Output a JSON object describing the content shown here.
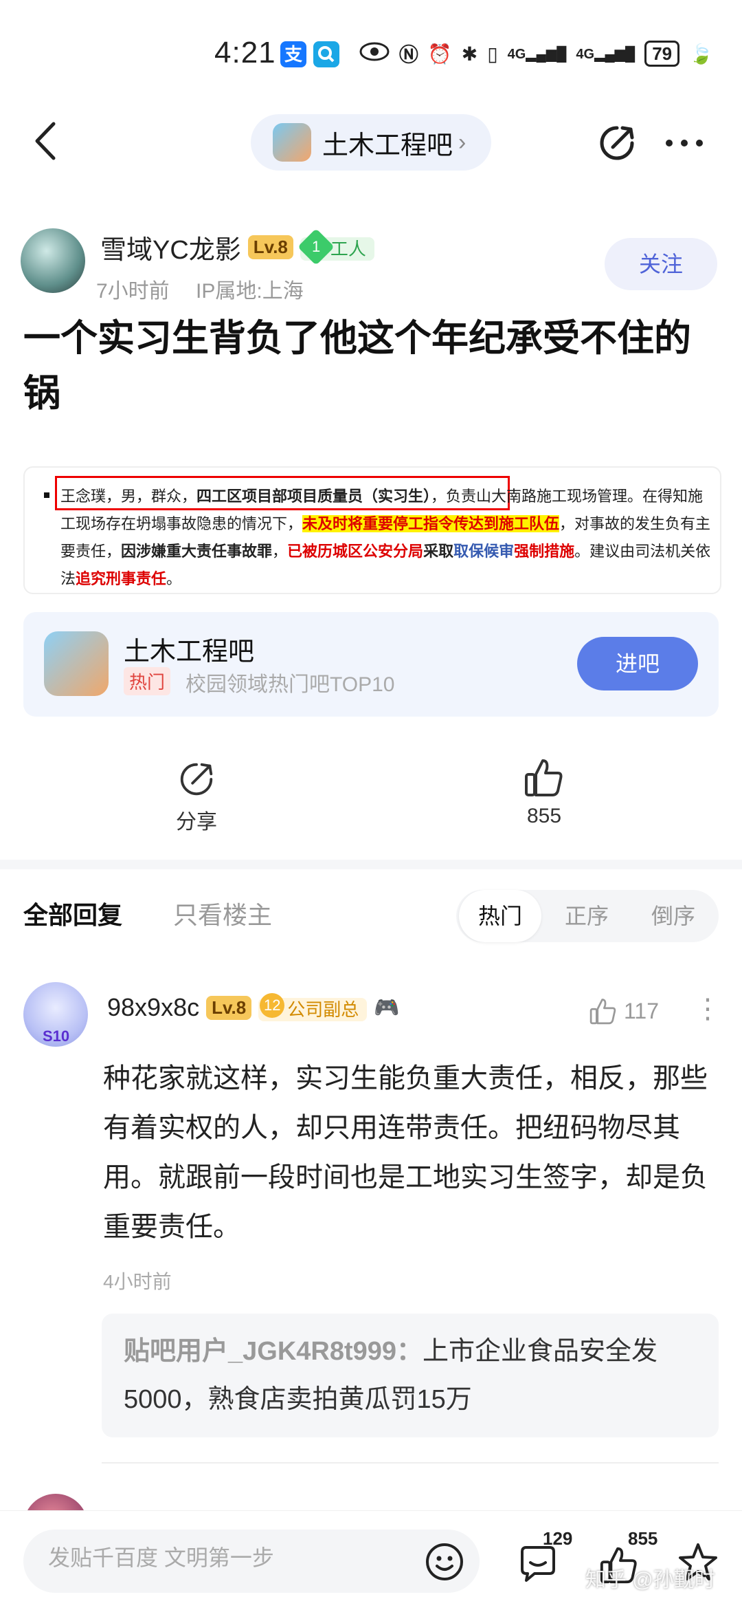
{
  "status_bar": {
    "time": "4:21",
    "app1": "支",
    "app1_color": "#1677ff",
    "app2_color": "#1ba7e6",
    "network1": "4G",
    "network2": "4G",
    "battery": "79"
  },
  "nav": {
    "forum_name": "土木工程吧",
    "chevron": "›"
  },
  "post": {
    "author_name": "雪域YC龙影",
    "author_level": "Lv.8",
    "author_title_num": "1",
    "author_title": "工人",
    "time": "7小时前",
    "ip": "IP属地:上海",
    "follow_label": "关注",
    "title": "一个实习生背负了他这个年纪承受不住的锅",
    "image_text": {
      "p1": "王念璞，男，群众，",
      "p2": "四工区项目部项目质量员（实习生）",
      "p3": "，负责山大南路施工现场管理。在得知施工现场存在坍塌事故隐患的情况下，",
      "p4": "未及时将重要停工指令传达到施工队伍",
      "p5": "，对事故的发生负有主要责任，",
      "p6": "因涉嫌重大责任事故罪",
      "p7": "，",
      "p8": "已被历城区公安分局",
      "p9": "采取",
      "p10": "取保候审",
      "p11": "强制措施",
      "p12": "。建议由司法机关依法",
      "p13": "追究刑事责任",
      "p14": "。"
    }
  },
  "forum_card": {
    "name": "土木工程吧",
    "hot_tag": "热门",
    "description": "校园领域热门吧TOP10",
    "enter_label": "进吧"
  },
  "actions": {
    "share_label": "分享",
    "like_count": "855"
  },
  "reply_tabs": {
    "all": "全部回复",
    "owner_only": "只看楼主",
    "sort": [
      "热门",
      "正序",
      "倒序"
    ]
  },
  "comment": {
    "s10": "S10",
    "username": "98x9x8c",
    "level": "Lv.8",
    "rank_num": "12",
    "rank_title": "公司副总",
    "like_count": "117",
    "body": "种花家就这样，实习生能负重大责任，相反，那些有着实权的人，却只用连带责任。把纽码物尽其用。就跟前一段时间也是工地实习生签字，却是负重要责任。",
    "time": "4小时前",
    "sub_reply_user": "贴吧用户_JGK4R8t999：",
    "sub_reply_text": "上市企业食品安全发5000，熟食店卖拍黄瓜罚15万"
  },
  "bottom_bar": {
    "input_placeholder": "发贴千百度 文明第一步",
    "comment_count": "129",
    "like_count": "855"
  },
  "watermark": "知乎 @孙觐时"
}
